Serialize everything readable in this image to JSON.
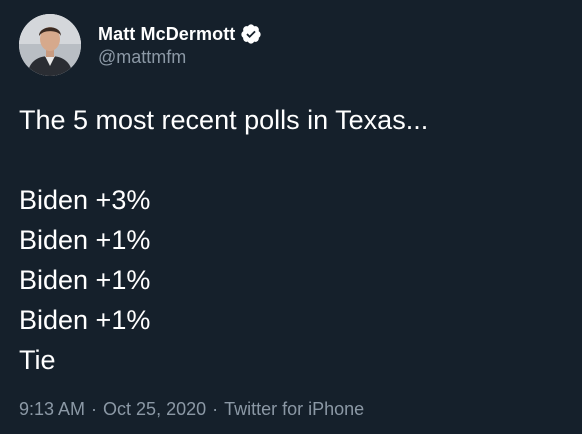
{
  "author": {
    "display_name": "Matt McDermott",
    "handle": "@mattmfm",
    "verified": true,
    "avatar_icon": "profile-photo"
  },
  "tweet": {
    "intro": "The 5 most recent polls in Texas...",
    "lines": [
      "Biden +3%",
      "Biden +1%",
      "Biden +1%",
      "Biden +1%",
      "Tie"
    ]
  },
  "meta": {
    "time": "9:13 AM",
    "date": "Oct 25, 2020",
    "separator": "·",
    "source": "Twitter for iPhone"
  },
  "colors": {
    "background": "#15202b",
    "text": "#ffffff",
    "secondary": "#8b98a5",
    "verified": "#ffffff"
  }
}
